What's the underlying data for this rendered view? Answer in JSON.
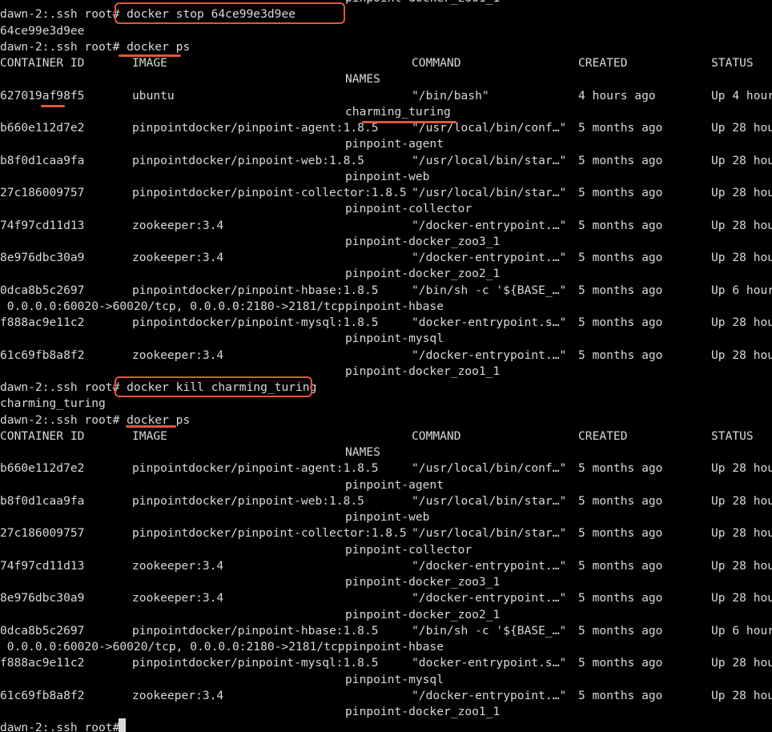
{
  "colors": {
    "background": "#000000",
    "text": "#d9d9d9",
    "annotation": "#e0583a"
  },
  "terminal": {
    "lines": [
      [
        "",
        "",
        "",
        "pinpoint-docker_zoo1_1",
        "",
        ""
      ],
      [
        "dawn-2:.ssh root# docker stop 64ce99e3d9ee",
        "",
        "",
        "",
        "",
        ""
      ],
      [
        "64ce99e3d9ee",
        "",
        "",
        "",
        "",
        ""
      ],
      [
        "dawn-2:.ssh root# docker ps",
        "",
        "",
        "",
        "",
        ""
      ],
      [
        "CONTAINER ID",
        "IMAGE",
        "COMMAND",
        "",
        "CREATED",
        "STATUS"
      ],
      [
        "",
        "",
        "",
        "NAMES",
        "",
        ""
      ],
      [
        "627019af98f5",
        "ubuntu",
        "\"/bin/bash\"",
        "",
        "4 hours ago",
        "Up 4 hour"
      ],
      [
        "",
        "",
        "",
        "charming_turing",
        "",
        ""
      ],
      [
        "b660e112d7e2",
        "pinpointdocker/pinpoint-agent:1.8.5",
        "\"/usr/local/bin/conf…\"",
        "",
        "5 months ago",
        "Up 28 hou"
      ],
      [
        "",
        "",
        "",
        "pinpoint-agent",
        "",
        ""
      ],
      [
        "b8f0d1caa9fa",
        "pinpointdocker/pinpoint-web:1.8.5",
        "\"/usr/local/bin/star…\"",
        "",
        "5 months ago",
        "Up 28 hou"
      ],
      [
        "",
        "",
        "",
        "pinpoint-web",
        "",
        ""
      ],
      [
        "27c186009757",
        "pinpointdocker/pinpoint-collector:1.8.5",
        "\"/usr/local/bin/star…\"",
        "",
        "5 months ago",
        "Up 28 hou"
      ],
      [
        "",
        "",
        "",
        "pinpoint-collector",
        "",
        ""
      ],
      [
        "74f97cd11d13",
        "zookeeper:3.4",
        "\"/docker-entrypoint.…\"",
        "",
        "5 months ago",
        "Up 28 hou"
      ],
      [
        "",
        "",
        "",
        "pinpoint-docker_zoo3_1",
        "",
        ""
      ],
      [
        "8e976dbc30a9",
        "zookeeper:3.4",
        "\"/docker-entrypoint.…\"",
        "",
        "5 months ago",
        "Up 28 hou"
      ],
      [
        "",
        "",
        "",
        "pinpoint-docker_zoo2_1",
        "",
        ""
      ],
      [
        "0dca8b5c2697",
        "pinpointdocker/pinpoint-hbase:1.8.5",
        "\"/bin/sh -c '${BASE_…\"",
        "",
        "5 months ago",
        "Up 6 hour"
      ],
      [
        " 0.0.0.0:60020->60020/tcp, 0.0.0.0:2180->2181/tcp",
        "",
        "",
        "pinpoint-hbase",
        "",
        ""
      ],
      [
        "f888ac9e11c2",
        "pinpointdocker/pinpoint-mysql:1.8.5",
        "\"docker-entrypoint.s…\"",
        "",
        "5 months ago",
        "Up 28 hou"
      ],
      [
        "",
        "",
        "",
        "pinpoint-mysql",
        "",
        ""
      ],
      [
        "61c69fb8a8f2",
        "zookeeper:3.4",
        "\"/docker-entrypoint.…\"",
        "",
        "5 months ago",
        "Up 28 hou"
      ],
      [
        "",
        "",
        "",
        "pinpoint-docker_zoo1_1",
        "",
        ""
      ],
      [
        "dawn-2:.ssh root# docker kill charming_turing",
        "",
        "",
        "",
        "",
        ""
      ],
      [
        "charming_turing",
        "",
        "",
        "",
        "",
        ""
      ],
      [
        "dawn-2:.ssh root# docker ps",
        "",
        "",
        "",
        "",
        ""
      ],
      [
        "CONTAINER ID",
        "IMAGE",
        "COMMAND",
        "",
        "CREATED",
        "STATUS"
      ],
      [
        "",
        "",
        "",
        "NAMES",
        "",
        ""
      ],
      [
        "b660e112d7e2",
        "pinpointdocker/pinpoint-agent:1.8.5",
        "\"/usr/local/bin/conf…\"",
        "",
        "5 months ago",
        "Up 28 hou"
      ],
      [
        "",
        "",
        "",
        "pinpoint-agent",
        "",
        ""
      ],
      [
        "b8f0d1caa9fa",
        "pinpointdocker/pinpoint-web:1.8.5",
        "\"/usr/local/bin/star…\"",
        "",
        "5 months ago",
        "Up 28 hou"
      ],
      [
        "",
        "",
        "",
        "pinpoint-web",
        "",
        ""
      ],
      [
        "27c186009757",
        "pinpointdocker/pinpoint-collector:1.8.5",
        "\"/usr/local/bin/star…\"",
        "",
        "5 months ago",
        "Up 28 hou"
      ],
      [
        "",
        "",
        "",
        "pinpoint-collector",
        "",
        ""
      ],
      [
        "74f97cd11d13",
        "zookeeper:3.4",
        "\"/docker-entrypoint.…\"",
        "",
        "5 months ago",
        "Up 28 hou"
      ],
      [
        "",
        "",
        "",
        "pinpoint-docker_zoo3_1",
        "",
        ""
      ],
      [
        "8e976dbc30a9",
        "zookeeper:3.4",
        "\"/docker-entrypoint.…\"",
        "",
        "5 months ago",
        "Up 28 hou"
      ],
      [
        "",
        "",
        "",
        "pinpoint-docker_zoo2_1",
        "",
        ""
      ],
      [
        "0dca8b5c2697",
        "pinpointdocker/pinpoint-hbase:1.8.5",
        "\"/bin/sh -c '${BASE_…\"",
        "",
        "5 months ago",
        "Up 6 hour"
      ],
      [
        " 0.0.0.0:60020->60020/tcp, 0.0.0.0:2180->2181/tcp",
        "",
        "",
        "pinpoint-hbase",
        "",
        ""
      ],
      [
        "f888ac9e11c2",
        "pinpointdocker/pinpoint-mysql:1.8.5",
        "\"docker-entrypoint.s…\"",
        "",
        "5 months ago",
        "Up 28 hou"
      ],
      [
        "",
        "",
        "",
        "pinpoint-mysql",
        "",
        ""
      ],
      [
        "61c69fb8a8f2",
        "zookeeper:3.4",
        "\"/docker-entrypoint.…\"",
        "",
        "5 months ago",
        "Up 28 hou"
      ],
      [
        "",
        "",
        "",
        "pinpoint-docker_zoo1_1",
        "",
        ""
      ],
      [
        "dawn-2:.ssh root# ",
        "",
        "",
        "",
        "",
        ""
      ]
    ]
  }
}
